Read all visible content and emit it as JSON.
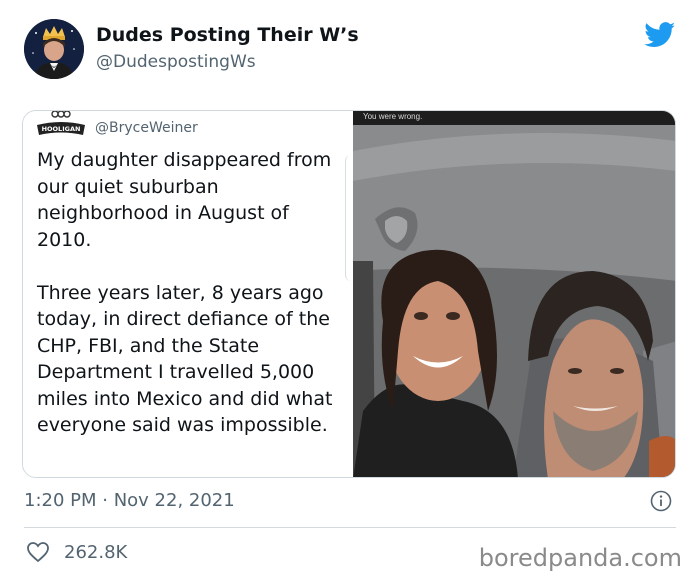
{
  "author": {
    "display_name": "Dudes Posting Their W’s",
    "handle": "@DudespostingWs"
  },
  "quoted_tweet": {
    "handle": "@BryceWeiner",
    "logo_text": "HOOLIGAN",
    "text": "My daughter disappeared from our quiet suburban neighborhood in August of 2010.\n\nThree years later, 8 years ago today, in direct defiance of the CHP, FBI, and the State Department I travelled 5,000 miles into Mexico and did what everyone said was impossible."
  },
  "photo": {
    "caption": "You were wrong."
  },
  "meta": {
    "timestamp": "1:20 PM · Nov 22, 2021",
    "likes": "262.8K"
  },
  "watermark": "boredpanda.com",
  "colors": {
    "twitter_blue": "#1d9bf0",
    "secondary_text": "#536471",
    "border": "#cfd9de"
  }
}
